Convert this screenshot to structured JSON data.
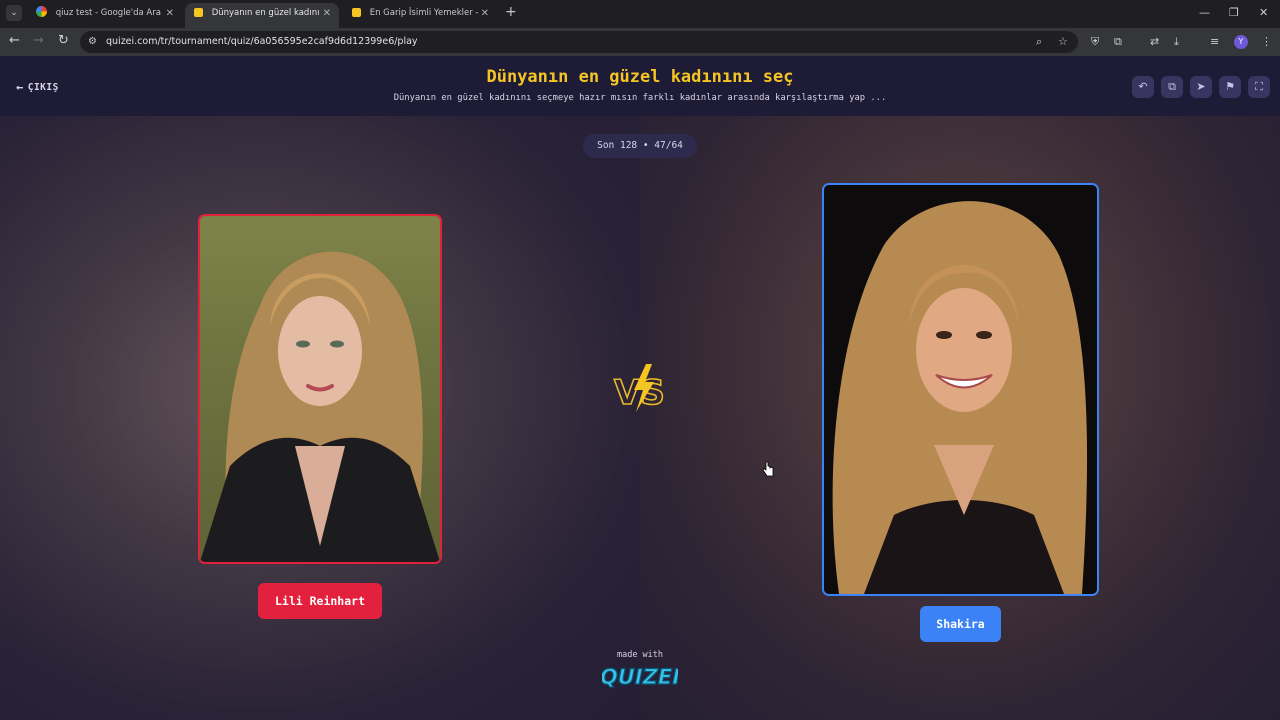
{
  "browser": {
    "tabs": [
      {
        "title": "qiuz test - Google'da Ara",
        "active": false,
        "favicon": "google-icon"
      },
      {
        "title": "Dünyanın en güzel kadınını seç",
        "active": true,
        "favicon": "quizei-icon"
      },
      {
        "title": "En Garip İsimli Yemekler - Tier L",
        "active": false,
        "favicon": "quizei-icon"
      }
    ],
    "url": "quizei.com/tr/tournament/quiz/6a056595e2caf9d6d12399e6/play",
    "profile_initial": "Y"
  },
  "header": {
    "exit_label": "ÇIKIŞ",
    "title": "Dünyanın en güzel kadınını seç",
    "description": "Dünyanın en güzel kadınını seçmeye hazır mısın farklı kadınlar arasında karşılaştırma yap ...",
    "actions": [
      "undo-icon",
      "share-icon",
      "send-icon",
      "flag-icon",
      "fullscreen-icon"
    ]
  },
  "round": {
    "label": "Son 128 • 47/64"
  },
  "contestants": {
    "left": {
      "name": "Lili Reinhart",
      "color": "#e3213f"
    },
    "right": {
      "name": "Shakira",
      "color": "#3b82f6"
    }
  },
  "vs_label": "VS",
  "footer": {
    "made_with": "made with",
    "brand": "QUIZEI"
  },
  "colors": {
    "title_accent": "#f5c523",
    "header_bg": "#1e1b36"
  }
}
